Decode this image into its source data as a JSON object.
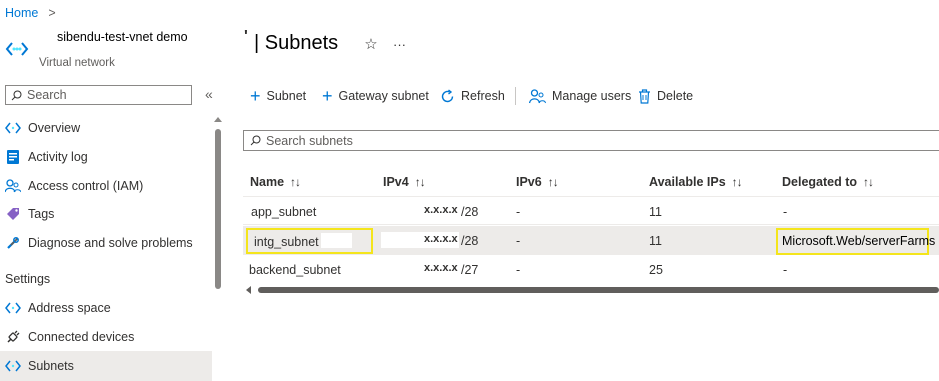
{
  "breadcrumb": {
    "home": "Home",
    "separator": ">"
  },
  "resource": {
    "name": "sibendu-test-vnet demo",
    "type": "Virtual network",
    "page_title_prefix": "'",
    "page_title": "| Subnets",
    "more": "···"
  },
  "sidebar": {
    "search_placeholder": "Search",
    "collapse": "«",
    "items": [
      {
        "label": "Overview",
        "icon": "vnet-icon"
      },
      {
        "label": "Activity log",
        "icon": "activity-log-icon"
      },
      {
        "label": "Access control (IAM)",
        "icon": "iam-icon"
      },
      {
        "label": "Tags",
        "icon": "tag-icon"
      },
      {
        "label": "Diagnose and solve problems",
        "icon": "wrench-icon"
      }
    ],
    "section_settings": "Settings",
    "settings_items": [
      {
        "label": "Address space",
        "icon": "vnet-icon"
      },
      {
        "label": "Connected devices",
        "icon": "plug-icon"
      },
      {
        "label": "Subnets",
        "icon": "vnet-icon",
        "selected": true
      }
    ]
  },
  "toolbar": {
    "subnet": "Subnet",
    "gateway_subnet": "Gateway subnet",
    "refresh": "Refresh",
    "manage_users": "Manage users",
    "delete": "Delete"
  },
  "search": {
    "placeholder": "Search subnets"
  },
  "table": {
    "columns": [
      "Name",
      "IPv4",
      "IPv6",
      "Available IPs",
      "Delegated to"
    ],
    "sort_glyph": "↑↓",
    "rows": [
      {
        "name": "app_subnet",
        "ipv4": "x.x.x.x",
        "prefix": "/28",
        "ipv6": "-",
        "available": "11",
        "delegated": "-"
      },
      {
        "name": "intg_subnet",
        "ipv4": "x.x.x.x",
        "prefix": "/28",
        "ipv6": "-",
        "available": "11",
        "delegated": "Microsoft.Web/serverFarms",
        "highlighted": true
      },
      {
        "name": "backend_subnet",
        "ipv4": "x.x.x.x",
        "prefix": "/27",
        "ipv6": "-",
        "available": "25",
        "delegated": "-"
      }
    ]
  },
  "colors": {
    "accent": "#0078d4",
    "highlight": "#f4e51c",
    "selected_bg": "#edebe9"
  }
}
